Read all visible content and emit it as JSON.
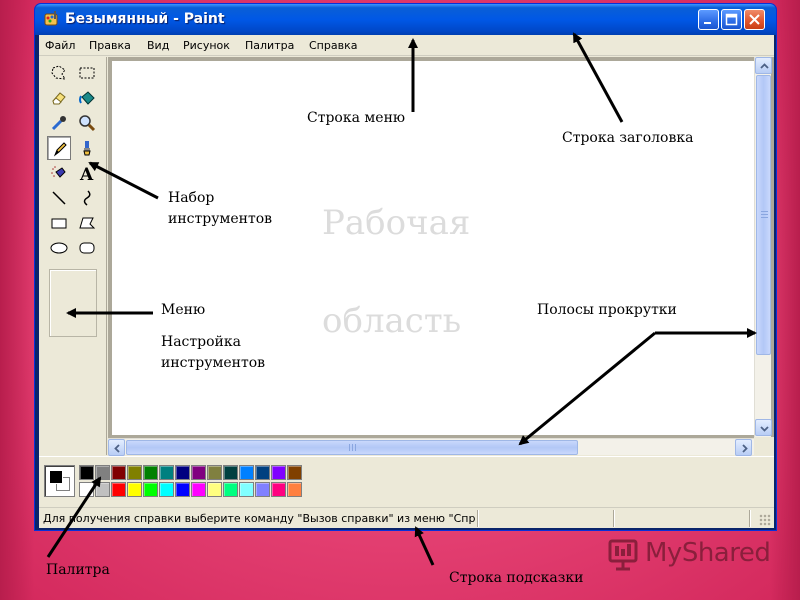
{
  "window": {
    "title": "Безымянный - Paint",
    "titlebar_color": "#0058e6",
    "title_icon": "paint-app-icon",
    "controls": [
      "minimize-icon",
      "maximize-icon",
      "close-icon"
    ]
  },
  "menubar": {
    "items": [
      {
        "label": "Файл"
      },
      {
        "label": "Правка"
      },
      {
        "label": "Вид"
      },
      {
        "label": "Рисунок"
      },
      {
        "label": "Палитра"
      },
      {
        "label": "Справка"
      }
    ]
  },
  "toolbox": {
    "tools": [
      {
        "icon": "free-select-icon"
      },
      {
        "icon": "rect-select-icon"
      },
      {
        "icon": "eraser-icon"
      },
      {
        "icon": "fill-bucket-icon"
      },
      {
        "icon": "color-picker-icon"
      },
      {
        "icon": "magnifier-icon"
      },
      {
        "icon": "pencil-icon",
        "selected": true
      },
      {
        "icon": "brush-icon"
      },
      {
        "icon": "airbrush-icon"
      },
      {
        "icon": "text-icon",
        "glyph": "A"
      },
      {
        "icon": "line-icon"
      },
      {
        "icon": "curve-icon"
      },
      {
        "icon": "rectangle-icon"
      },
      {
        "icon": "polygon-icon"
      },
      {
        "icon": "ellipse-icon"
      },
      {
        "icon": "rounded-rect-icon"
      }
    ]
  },
  "palette": {
    "foreground": "#000000",
    "background": "#ffffff",
    "top_row": [
      "#000000",
      "#808080",
      "#800000",
      "#808000",
      "#008000",
      "#008080",
      "#000080",
      "#800080",
      "#808040",
      "#004040",
      "#0080ff",
      "#004080",
      "#8000ff",
      "#804000"
    ],
    "bottom_row": [
      "#ffffff",
      "#c0c0c0",
      "#ff0000",
      "#ffff00",
      "#00ff00",
      "#00ffff",
      "#0000ff",
      "#ff00ff",
      "#ffff80",
      "#00ff80",
      "#80ffff",
      "#8080ff",
      "#ff0080",
      "#ff8040"
    ]
  },
  "statusbar": {
    "text": "Для получения справки выберите команду \"Вызов справки\" из меню \"Спр"
  },
  "annotations": {
    "menu_row": "Строка меню",
    "title_row": "Строка заголовка",
    "toolset": [
      "Набор",
      "инструментов"
    ],
    "work_area": [
      "Рабочая",
      "область"
    ],
    "menu": "Меню",
    "tool_settings": [
      "Настройка",
      "инструментов"
    ],
    "scrollbars": "Полосы прокрутки",
    "palette": "Палитра",
    "hint_row": "Строка подсказки"
  },
  "logo": {
    "text": "MyShared",
    "icon": "myshared-logo-icon"
  }
}
